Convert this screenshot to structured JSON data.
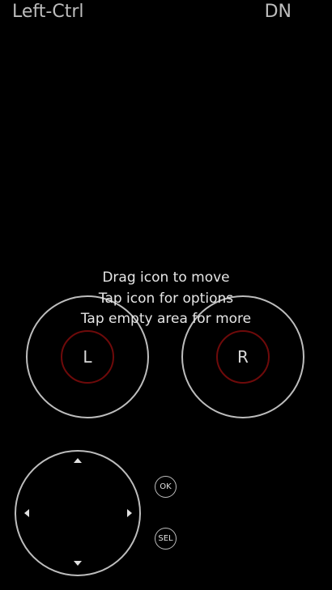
{
  "header": {
    "key_label": "Left-Ctrl",
    "state_label": "DN"
  },
  "hints": [
    "Drag icon to move",
    "Tap icon for options",
    "Tap empty area for more"
  ],
  "sticks": {
    "left": {
      "label": "L"
    },
    "right": {
      "label": "R"
    }
  },
  "dpad": {
    "icons": [
      "arrow-up-icon",
      "arrow-down-icon",
      "arrow-left-icon",
      "arrow-right-icon"
    ]
  },
  "buttons": {
    "ok": "OK",
    "select": "SEL"
  },
  "colors": {
    "background": "#000000",
    "outline": "#bdbdbd",
    "knob_outline": "#6e0a0a",
    "text": "#e6e6e6"
  }
}
